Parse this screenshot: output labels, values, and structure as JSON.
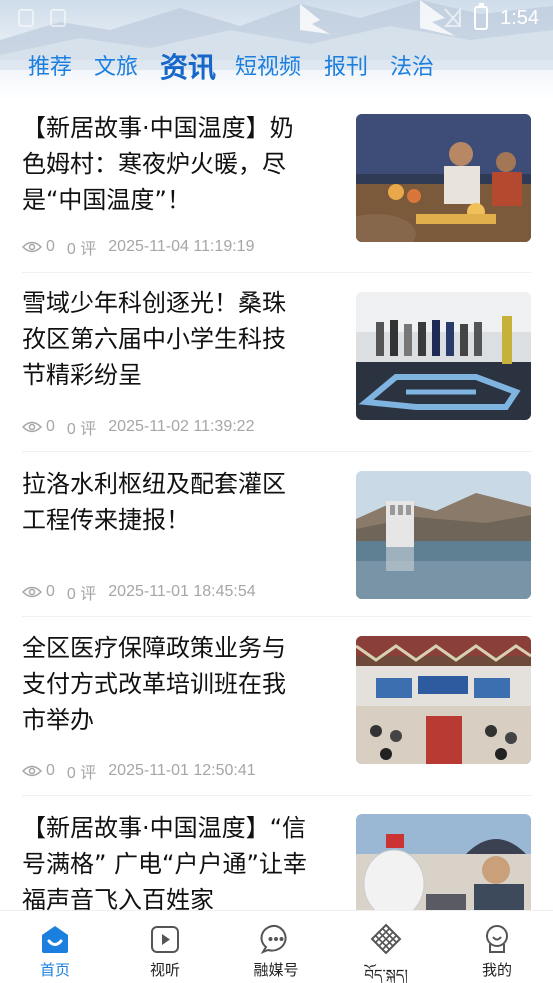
{
  "status_bar": {
    "time": "1:54"
  },
  "tabs": [
    {
      "label": "推荐"
    },
    {
      "label": "文旅"
    },
    {
      "label": "资讯",
      "active": true
    },
    {
      "label": "短视频"
    },
    {
      "label": "报刊"
    },
    {
      "label": "法治"
    }
  ],
  "articles": [
    {
      "title_lines": [
        "【新居故事·中国温度】奶",
        "色姆村：寒夜炉火暖，尽",
        "是“中国温度”！"
      ],
      "views": "0",
      "comments": "0 评",
      "date": "2025-11-04 11:19:19"
    },
    {
      "title_lines": [
        "雪域少年科创逐光！桑珠",
        "孜区第六届中小学生科技",
        "节精彩纷呈"
      ],
      "views": "0",
      "comments": "0 评",
      "date": "2025-11-02 11:39:22"
    },
    {
      "title_lines": [
        "拉洛水利枢纽及配套灌区",
        "工程传来捷报！"
      ],
      "views": "0",
      "comments": "0 评",
      "date": "2025-11-01 18:45:54"
    },
    {
      "title_lines": [
        "全区医疗保障政策业务与",
        "支付方式改革培训班在我",
        "市举办"
      ],
      "views": "0",
      "comments": "0 评",
      "date": "2025-11-01 12:50:41"
    },
    {
      "title_lines": [
        "【新居故事·中国温度】“信",
        "号满格” 广电“户户通”让幸",
        "福声音飞入百姓家"
      ],
      "views": "",
      "comments": "",
      "date": ""
    }
  ],
  "bottom_nav": [
    {
      "label": "首页",
      "active": true
    },
    {
      "label": "视听"
    },
    {
      "label": "融媒号"
    },
    {
      "label": "བོད་སྐད།"
    },
    {
      "label": "我的"
    }
  ],
  "colors": {
    "accent": "#1b7fe0",
    "meta": "#a6a6a6",
    "title": "#111111"
  }
}
